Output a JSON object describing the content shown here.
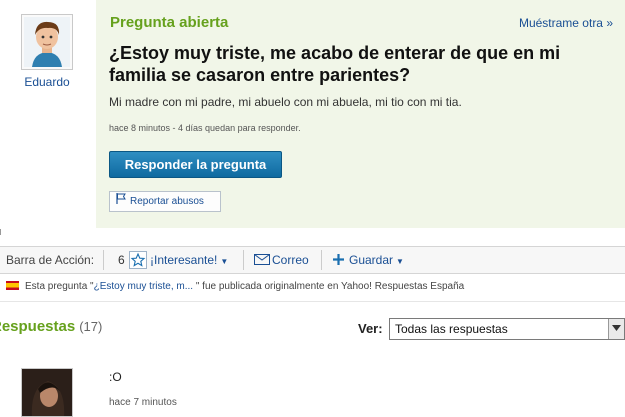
{
  "question": {
    "status": "Pregunta abierta",
    "show_me": "Muéstrame otra »",
    "title": "¿Estoy muy triste, me acabo de enterar de que en mi familia se casaron entre parientes?",
    "body": "Mi madre con mi padre, mi abuelo con mi abuela, mi tio con mi tia.",
    "meta": "hace 8 minutos - 4 días quedan para responder.",
    "answer_button": "Responder la pregunta",
    "report_button": "Reportar abusos"
  },
  "asker": {
    "name": "Eduardo"
  },
  "action_bar": {
    "label": "Barra de Acción:",
    "count": "6",
    "interesting": "¡Interesante!",
    "mail": "Correo",
    "save": "Guardar"
  },
  "origin": {
    "prefix": "Esta pregunta \"",
    "question_link": "¿Estoy muy triste, m...",
    "suffix": " \" fue publicada originalmente en Yahoo! Respuestas España"
  },
  "answers": {
    "title": "Respuestas",
    "count": "(17)",
    "filter_label": "Ver:",
    "filter_value": "Todas las respuestas",
    "items": [
      {
        "text": ":O",
        "meta": "hace 7 minutos"
      }
    ]
  },
  "colors": {
    "green": "#66a11d",
    "link_blue": "#1a4f94",
    "button_blue": "#1a7ab4"
  }
}
